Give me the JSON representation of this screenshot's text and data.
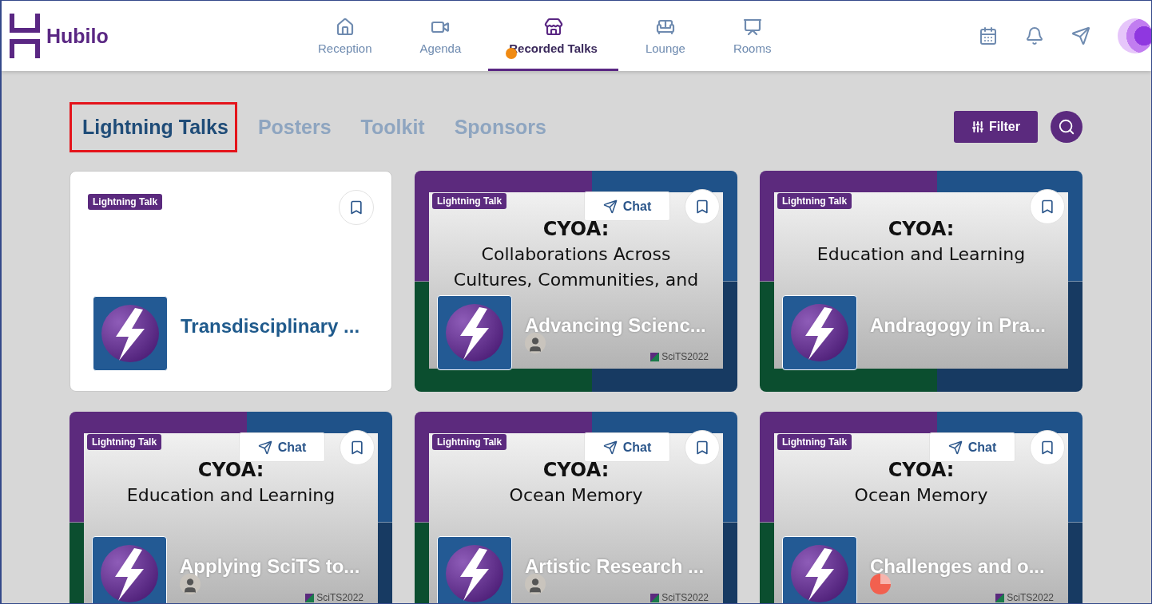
{
  "header": {
    "brand": "Hubilo",
    "nav": [
      {
        "label": "Reception",
        "selected": false
      },
      {
        "label": "Agenda",
        "selected": false
      },
      {
        "label": "Recorded Talks",
        "selected": true
      },
      {
        "label": "Lounge",
        "selected": false
      },
      {
        "label": "Rooms",
        "selected": false
      }
    ]
  },
  "tabs": [
    {
      "label": "Lightning Talks",
      "selected": true
    },
    {
      "label": "Posters",
      "selected": false
    },
    {
      "label": "Toolkit",
      "selected": false
    },
    {
      "label": "Sponsors",
      "selected": false
    }
  ],
  "filter_button": "Filter",
  "cards": [
    {
      "kind": "plain",
      "badge": "Lightning Talk",
      "title": "Transdisciplinary ..."
    },
    {
      "kind": "slide",
      "badge": "Lightning Talk",
      "chat": "Chat",
      "slide_lines": [
        "CYOA:",
        "Collaborations Across",
        "Cultures, Communities, and"
      ],
      "title": "Advancing Scienc...",
      "avatar": {
        "kind": "photo"
      },
      "watermark": "SciTS2022"
    },
    {
      "kind": "slide",
      "badge": "Lightning Talk",
      "slide_lines": [
        "CYOA:",
        "Education and Learning"
      ],
      "title": "Andragogy in Pra..."
    },
    {
      "kind": "slide",
      "badge": "Lightning Talk",
      "chat": "Chat",
      "slide_lines": [
        "CYOA:",
        "Education and Learning"
      ],
      "title": "Applying SciTS to...",
      "avatar": {
        "kind": "photo"
      },
      "watermark": "SciTS2022"
    },
    {
      "kind": "slide",
      "badge": "Lightning Talk",
      "chat": "Chat",
      "slide_lines": [
        "CYOA:",
        "Ocean Memory"
      ],
      "title": "Artistic Research ...",
      "avatar": {
        "kind": "photo"
      },
      "watermark": "SciTS2022"
    },
    {
      "kind": "slide",
      "badge": "Lightning Talk",
      "chat": "Chat",
      "slide_lines": [
        "CYOA:",
        "Ocean Memory"
      ],
      "title": "Challenges and o...",
      "avatar": {
        "kind": "pie"
      },
      "watermark": "SciTS2022"
    }
  ]
}
